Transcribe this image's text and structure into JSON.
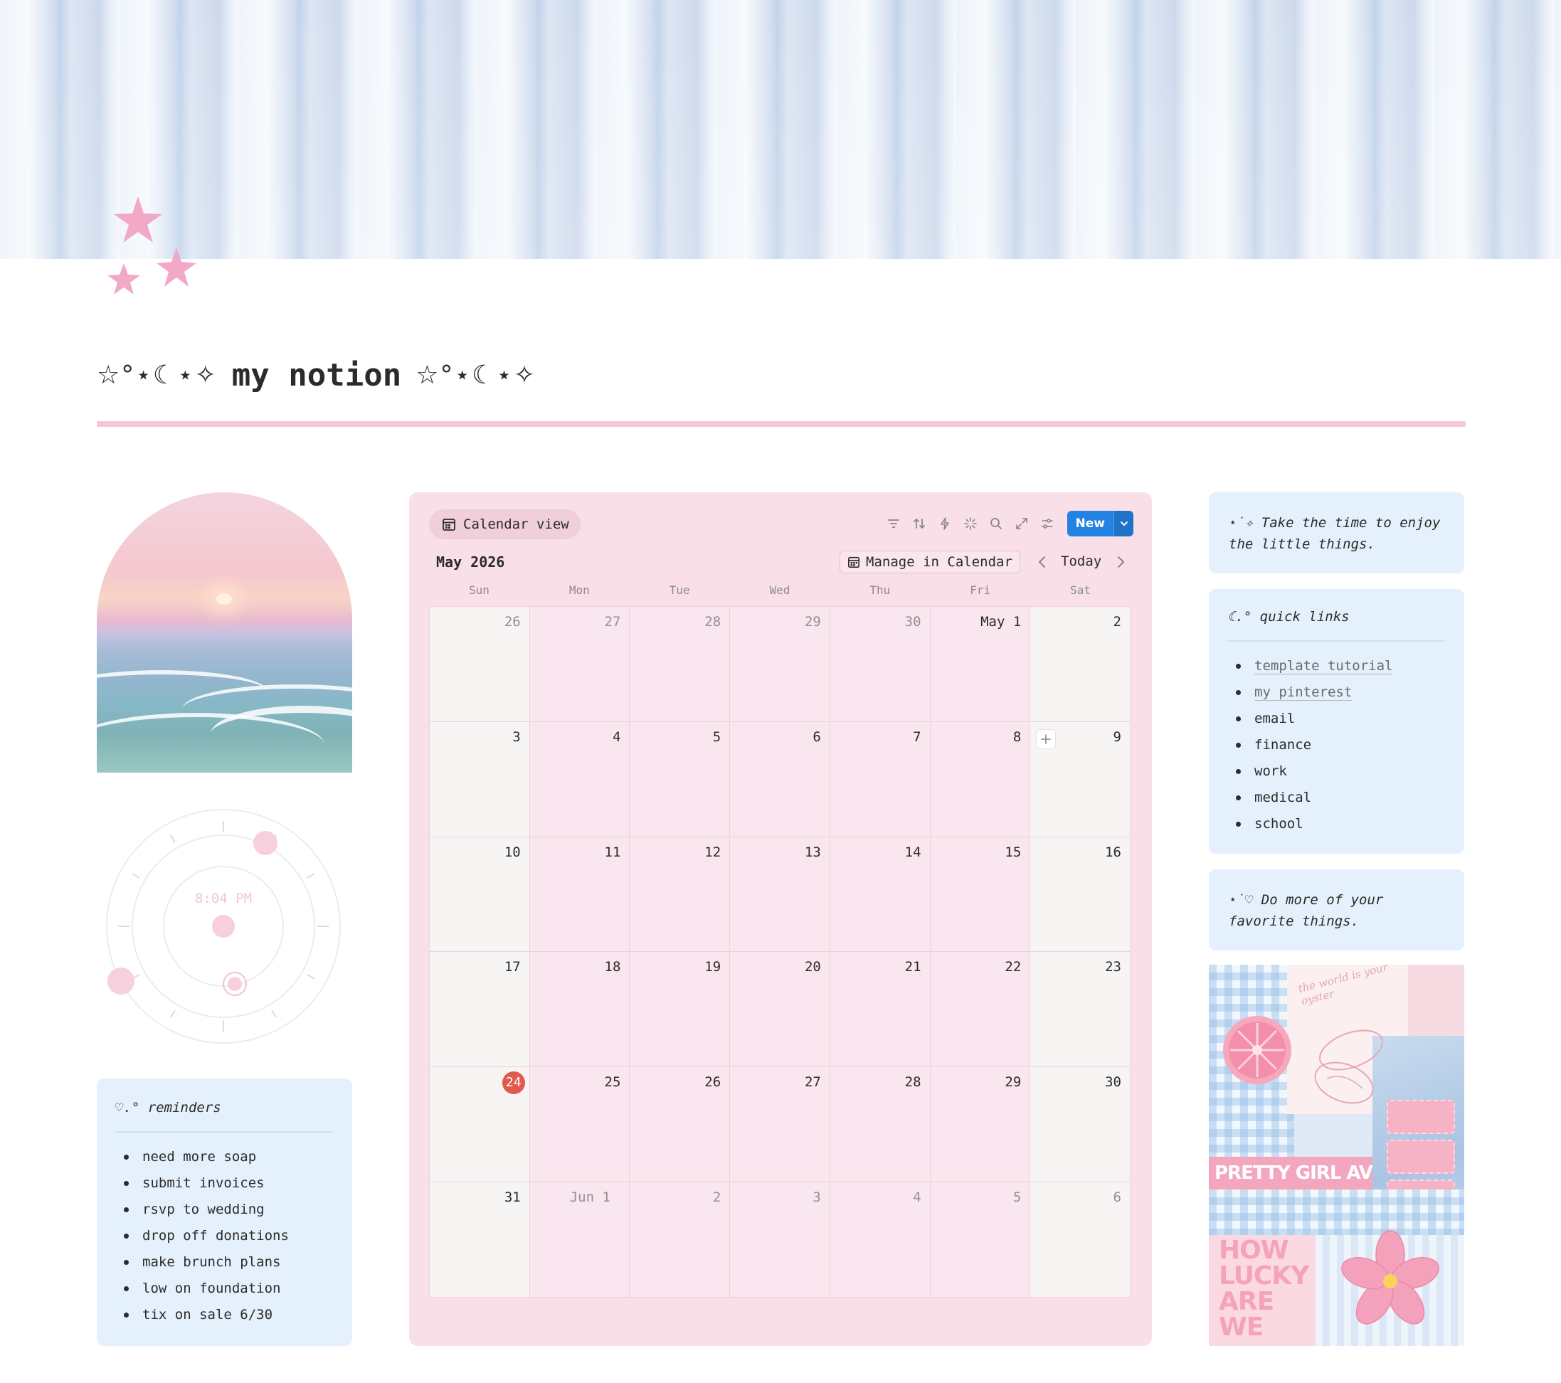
{
  "colors": {
    "accent_pink": "#f6c8d6",
    "calendar_bg": "#f8dfe8",
    "card_blue": "#e4f0fb",
    "new_button": "#2383e2",
    "today_marker": "#e05a4e"
  },
  "page": {
    "title_deco_left": "☆°⋆☾⋆✧",
    "title": "my notion",
    "title_deco_right": "☆°⋆☾⋆✧"
  },
  "clock": {
    "time": "8:04 PM"
  },
  "reminders": {
    "title": "♡.° reminders",
    "items": [
      "need more soap",
      "submit invoices",
      "rsvp to wedding",
      "drop off donations",
      "make brunch plans",
      "low on foundation",
      "tix on sale 6/30"
    ]
  },
  "calendar": {
    "view_label": "Calendar view",
    "new_label": "New",
    "month": "May 2026",
    "manage_label": "Manage in Calendar",
    "today_label": "Today",
    "weekdays": [
      "Sun",
      "Mon",
      "Tue",
      "Wed",
      "Thu",
      "Fri",
      "Sat"
    ],
    "weeks": [
      [
        "26",
        "27",
        "28",
        "29",
        "30",
        "May 1",
        "2"
      ],
      [
        "3",
        "4",
        "5",
        "6",
        "7",
        "8",
        "9"
      ],
      [
        "10",
        "11",
        "12",
        "13",
        "14",
        "15",
        "16"
      ],
      [
        "17",
        "18",
        "19",
        "20",
        "21",
        "22",
        "23"
      ],
      [
        "24",
        "25",
        "26",
        "27",
        "28",
        "29",
        "30"
      ],
      [
        "31",
        "Jun 1",
        "2",
        "3",
        "4",
        "5",
        "6"
      ]
    ]
  },
  "quote_top": {
    "text": "⋆˙✧ Take the time to enjoy the little things."
  },
  "quick_links": {
    "title": "☾.° quick links",
    "items": [
      "template tutorial",
      "my pinterest",
      "email",
      "finance",
      "work",
      "medical",
      "school"
    ]
  },
  "quote_bottom": {
    "text": "⋆˙♡ Do more of your favorite things."
  },
  "collage": {
    "sign_text": "PRETTY GIRL AVE",
    "quote_text": "HOW LUCKY ARE WE",
    "script_text": "the world is your oyster"
  }
}
